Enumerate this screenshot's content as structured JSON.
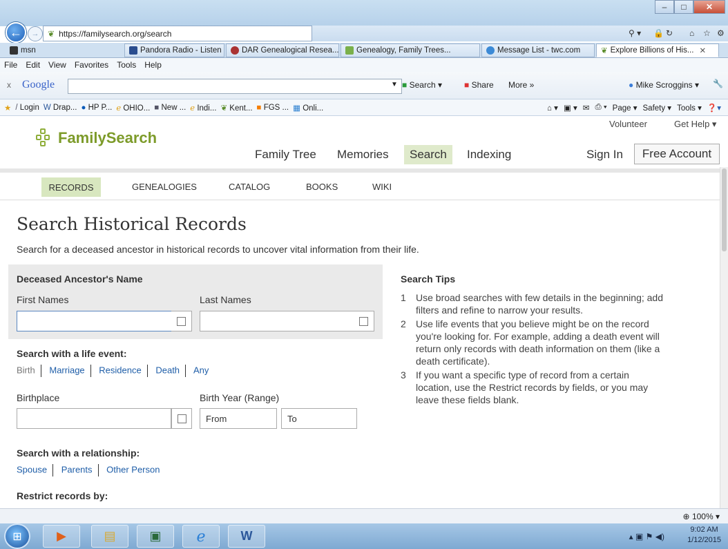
{
  "browser": {
    "url": "https://familysearch.org/search",
    "tabs": [
      {
        "label": "msn"
      },
      {
        "label": "Pandora Radio - Listen t..."
      },
      {
        "label": "DAR Genealogical Resea..."
      },
      {
        "label": "Genealogy, Family Trees..."
      },
      {
        "label": "Message List - twc.com"
      },
      {
        "label": "Explore Billions of His..."
      }
    ],
    "menu": [
      "File",
      "Edit",
      "View",
      "Favorites",
      "Tools",
      "Help"
    ],
    "google_bar": {
      "close": "x",
      "brand": "Google",
      "search": "Search",
      "share": "Share",
      "more": "More »",
      "user": "Mike Scroggins"
    },
    "favorites": [
      {
        "label": "Login"
      },
      {
        "label": "Drap..."
      },
      {
        "label": "HP P..."
      },
      {
        "label": "OHIO..."
      },
      {
        "label": "New ..."
      },
      {
        "label": "Indi..."
      },
      {
        "label": "Kent..."
      },
      {
        "label": "FGS ..."
      },
      {
        "label": "Onli..."
      }
    ],
    "command_bar": {
      "page": "Page",
      "safety": "Safety",
      "tools": "Tools"
    },
    "zoom": "100%"
  },
  "site": {
    "logo": "FamilySearch",
    "util_links": {
      "volunteer": "Volunteer",
      "help": "Get Help"
    },
    "nav": [
      "Family Tree",
      "Memories",
      "Search",
      "Indexing"
    ],
    "sign_in": "Sign In",
    "free_account": "Free Account",
    "subnav": [
      "RECORDS",
      "GENEALOGIES",
      "CATALOG",
      "BOOKS",
      "WIKI"
    ]
  },
  "main": {
    "title": "Search Historical Records",
    "intro": "Search for a deceased ancestor in historical records to uncover vital information from their life.",
    "name_section": {
      "heading": "Deceased Ancestor's Name",
      "first_label": "First Names",
      "last_label": "Last Names",
      "first_value": "",
      "last_value": ""
    },
    "life_event": {
      "heading": "Search with a life event:",
      "options": [
        "Birth",
        "Marriage",
        "Residence",
        "Death",
        "Any"
      ]
    },
    "birthplace_label": "Birthplace",
    "birth_year_label": "Birth Year (Range)",
    "from_placeholder": "From",
    "to_placeholder": "To",
    "relationship": {
      "heading": "Search with a relationship:",
      "options": [
        "Spouse",
        "Parents",
        "Other Person"
      ]
    },
    "restrict_heading": "Restrict records by:",
    "tips": {
      "heading": "Search Tips",
      "items": [
        "Use broad searches with few details in the beginning; add filters and refine to narrow your results.",
        "Use life events that you believe might be on the record you're looking for. For example, adding a death event will return only records with death information on them (like a death certificate).",
        "If you want a specific type of record from a certain location, use the Restrict records by fields, or you may leave these fields blank."
      ]
    }
  },
  "taskbar": {
    "time": "9:02 AM",
    "date": "1/12/2015"
  }
}
